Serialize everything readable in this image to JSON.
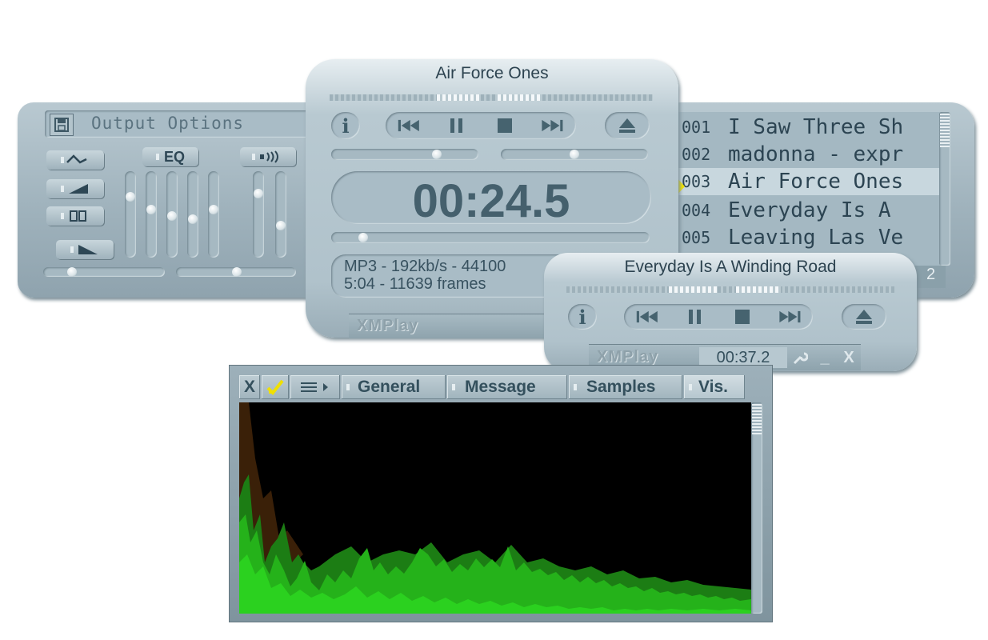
{
  "output_options": {
    "title": "Output Options",
    "eq_label": "EQ",
    "save_icon": "floppy-disk-icon",
    "mode_buttons": [
      "wave-icon",
      "ramp-icon",
      "dual-icon",
      "fade-icon"
    ],
    "speaker_icon": "speaker-icon"
  },
  "main_window": {
    "title": "Air Force Ones",
    "time": "00:24.5",
    "info_line1": "MP3 - 192kb/s - 44100",
    "info_line2": "5:04 - 11639 frames",
    "logo": "XMPlay"
  },
  "playlist": {
    "items": [
      {
        "num": "001",
        "title": "I Saw Three Sh"
      },
      {
        "num": "002",
        "title": "madonna - expr"
      },
      {
        "num": "003",
        "title": "Air Force Ones"
      },
      {
        "num": "004",
        "title": "Everyday Is A"
      },
      {
        "num": "005",
        "title": "Leaving Las Ve"
      }
    ],
    "current_index": 2,
    "footer_fragment": "2"
  },
  "mini_window": {
    "title": "Everyday Is A Winding Road",
    "logo": "XMPlay",
    "time": "00:37.2",
    "close_label": "X",
    "minimize_label": "_"
  },
  "vis_window": {
    "close_label": "X",
    "tabs": [
      "General",
      "Message",
      "Samples",
      "Vis."
    ]
  },
  "colors": {
    "vis_green": "#2bd11f",
    "vis_dark_green": "#1c7d14",
    "highlight": "#c8d7de",
    "marker": "#f3e400"
  }
}
